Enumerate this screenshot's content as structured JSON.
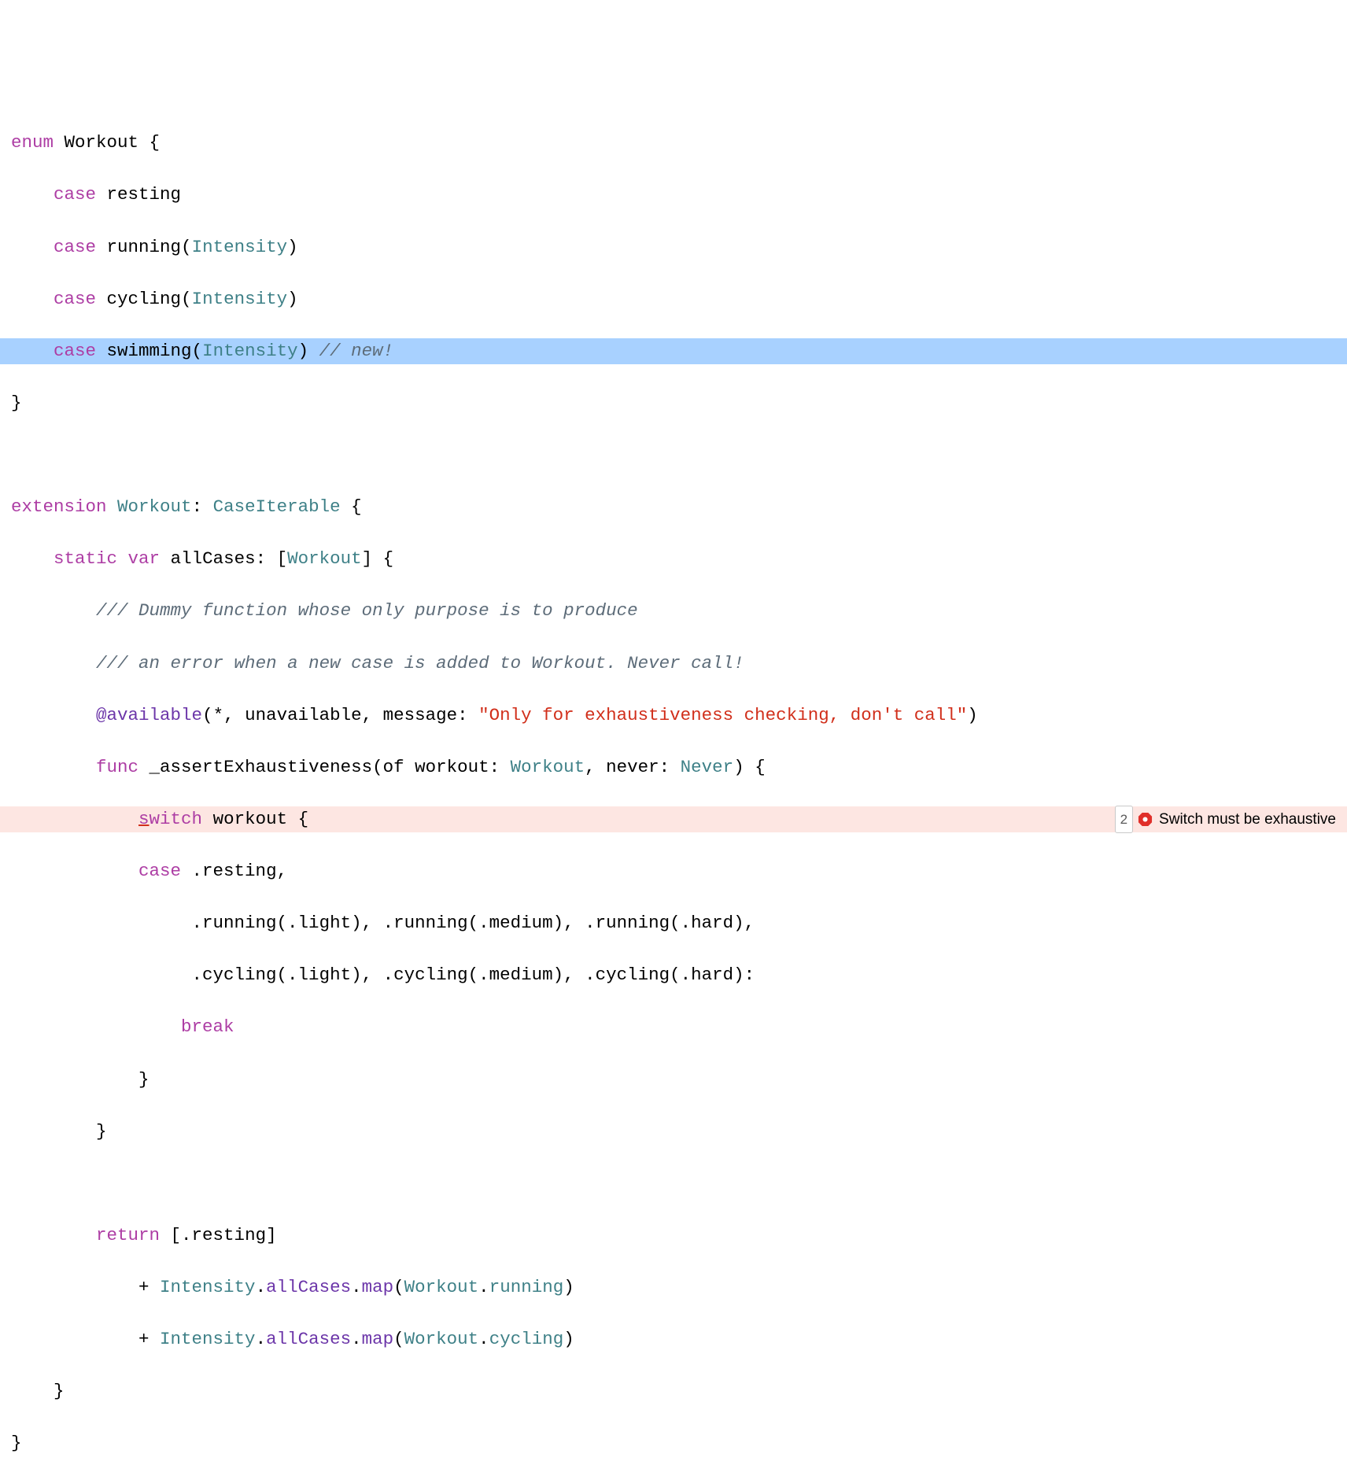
{
  "code": {
    "l01_enum": "enum",
    "l01_workout": "Workout",
    "l01_brace": " {",
    "l02_case": "case",
    "l02_name": " resting",
    "l03_case": "case",
    "l03_name": " running(",
    "l03_type": "Intensity",
    "l03_close": ")",
    "l04_case": "case",
    "l04_name": " cycling(",
    "l04_type": "Intensity",
    "l04_close": ")",
    "l05_case": "case",
    "l05_name": " swimming(",
    "l05_type": "Intensity",
    "l05_close": ") ",
    "l05_comment": "// new!",
    "l06": "}",
    "l08_ext": "extension",
    "l08_workout": "Workout",
    "l08_colon": ": ",
    "l08_ci": "CaseIterable",
    "l08_brace": " {",
    "l09_static": "static",
    "l09_var": "var",
    "l09_name": " allCases: [",
    "l09_type": "Workout",
    "l09_close": "] {",
    "l10_comment": "/// Dummy function whose only purpose is to produce",
    "l11_comment": "/// an error when a new case is added to Workout. Never call!",
    "l12_avail": "@available",
    "l12_args": "(*, unavailable, message: ",
    "l12_str": "\"Only for exhaustiveness checking, don't call\"",
    "l12_close": ")",
    "l13_func": "func",
    "l13_name": " _assertExhaustiveness(of workout: ",
    "l13_workout": "Workout",
    "l13_sep": ", never: ",
    "l13_never": "Never",
    "l13_close": ") {",
    "l14_s": "s",
    "l14_witch": "witch",
    "l14_workout": " workout {",
    "l15_case": "case",
    "l15_rest": " .resting,",
    "l16": "                 .running(.light), .running(.medium), .running(.hard),",
    "l17": "                 .cycling(.light), .cycling(.medium), .cycling(.hard):",
    "l18_break": "break",
    "l19": "            }",
    "l20": "        }",
    "l22_return": "return",
    "l22_rest": " [.resting]",
    "l23_pre": "            + ",
    "l23_intensity": "Intensity",
    "l23_dot1": ".",
    "l23_allcases": "allCases",
    "l23_dot2": ".",
    "l23_map": "map",
    "l23_paren": "(",
    "l23_workout": "Workout",
    "l23_dot3": ".",
    "l23_running": "running",
    "l23_close": ")",
    "l24_pre": "            + ",
    "l24_intensity": "Intensity",
    "l24_dot1": ".",
    "l24_allcases": "allCases",
    "l24_dot2": ".",
    "l24_map": "map",
    "l24_paren": "(",
    "l24_workout": "Workout",
    "l24_dot3": ".",
    "l24_cycling": "cycling",
    "l24_close": ")",
    "l25": "    }",
    "l26": "}"
  },
  "error": {
    "count": "2",
    "message": "Switch must be exhaustive"
  }
}
